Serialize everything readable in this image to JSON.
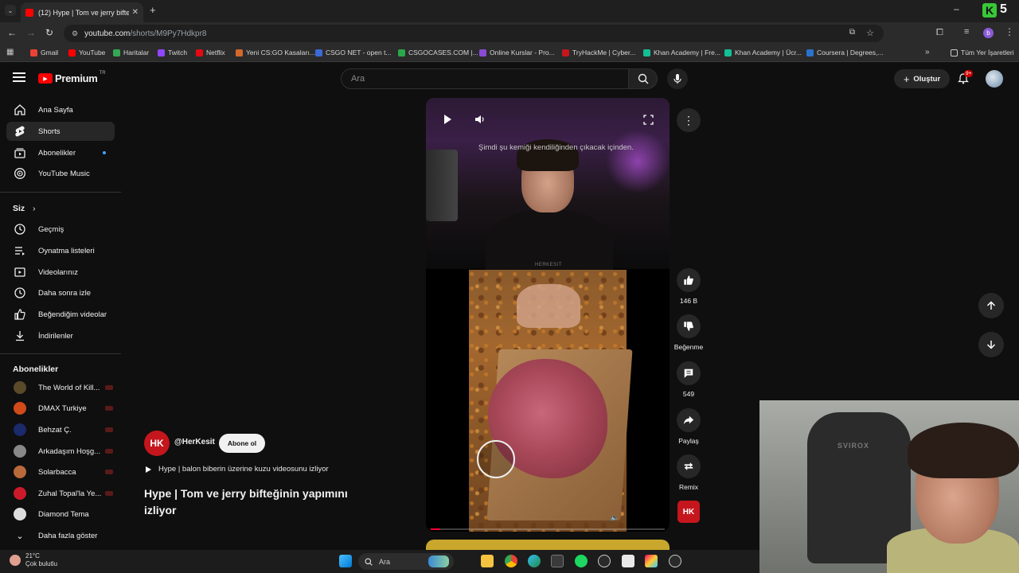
{
  "browser": {
    "tab_title": "(12) Hype | Tom ve jerry bifteği",
    "url_host": "youtube.com",
    "url_path": "/shorts/M9Py7Hdkpr8",
    "bookmarks": [
      "Gmail",
      "YouTube",
      "Haritalar",
      "Twitch",
      "Netflix",
      "Yeni CS:GO Kasaları...",
      "CSGO NET - open t...",
      "CSGOCASES.COM |...",
      "Online Kurslar - Pro...",
      "TryHackMe | Cyber...",
      "Khan Academy | Fre...",
      "Khan Academy | Ücr...",
      "Coursera | Degrees,..."
    ],
    "all_bookmarks": "Tüm Yer İşaretleri",
    "profile_initial": "b"
  },
  "overlay": {
    "k_letter": "K",
    "k_count": "5"
  },
  "header": {
    "logo_text": "Premium",
    "logo_badge": "TR",
    "search_placeholder": "Ara",
    "create_label": "Oluştur",
    "notif_count": "9+"
  },
  "sidebar": {
    "main": [
      {
        "label": "Ana Sayfa",
        "icon": "home-icon"
      },
      {
        "label": "Shorts",
        "icon": "shorts-icon"
      },
      {
        "label": "Abonelikler",
        "icon": "subscriptions-icon"
      },
      {
        "label": "YouTube Music",
        "icon": "music-icon"
      }
    ],
    "you_title": "Siz",
    "you": [
      {
        "label": "Geçmiş",
        "icon": "history-icon"
      },
      {
        "label": "Oynatma listeleri",
        "icon": "playlist-icon"
      },
      {
        "label": "Videolarınız",
        "icon": "your-videos-icon"
      },
      {
        "label": "Daha sonra izle",
        "icon": "watch-later-icon"
      },
      {
        "label": "Beğendiğim videolar",
        "icon": "liked-icon"
      },
      {
        "label": "İndirilenler",
        "icon": "download-icon"
      }
    ],
    "subs_title": "Abonelikler",
    "subs": [
      {
        "label": "The World of Kill...",
        "color": "#5a4a2a"
      },
      {
        "label": "DMAX Turkiye",
        "color": "#d04a1a"
      },
      {
        "label": "Behzat Ç.",
        "color": "#1a2a6a"
      },
      {
        "label": "Arkadaşım Hoşg...",
        "color": "#888888"
      },
      {
        "label": "Solarbacca",
        "color": "#b86a3a"
      },
      {
        "label": "Zuhal Topal'la Ye...",
        "color": "#cc1a2a"
      },
      {
        "label": "Diamond Tema",
        "color": "#dddddd"
      }
    ],
    "show_more": "Daha fazla göster"
  },
  "player": {
    "subtitle": "Şimdi şu kemiği kendiliğinden çıkacak içinden.",
    "watermark": "HERKESIT",
    "progress": 0.04
  },
  "actions": {
    "likes": "146 B",
    "dislike": "Beğenme",
    "comments": "549",
    "share": "Paylaş",
    "remix": "Remix"
  },
  "channel": {
    "avatar_text": "HK",
    "handle": "@HerKesit",
    "subscribe": "Abone ol",
    "related": "Hype | balon biberin üzerine kuzu videosunu izliyor",
    "title": "Hype | Tom ve jerry bifteğinin yapımını izliyor"
  },
  "webcam": {
    "chair_brand": "SVIROX"
  },
  "taskbar": {
    "temp": "21°C",
    "weather": "Çok bulutlu",
    "search": "Ara"
  },
  "colors": {
    "accent": "#ff0033",
    "channel_red": "#c4161c",
    "bg": "#0f0f0f"
  }
}
